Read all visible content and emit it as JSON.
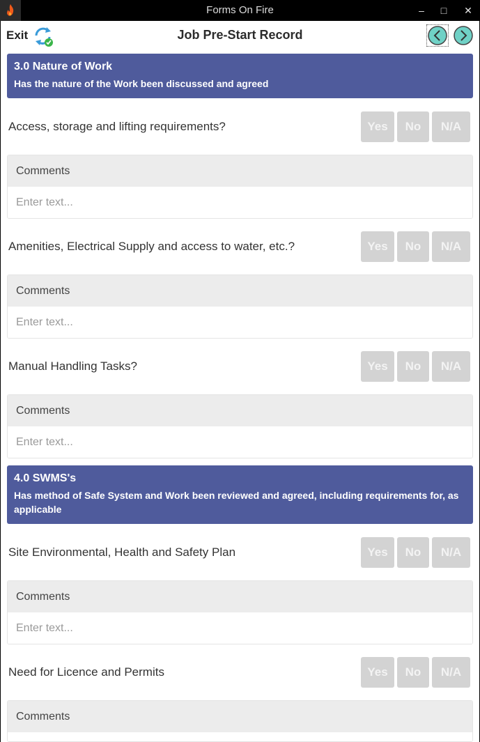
{
  "window": {
    "title": "Forms On Fire",
    "minimize_glyph": "‒",
    "maximize_glyph": "□",
    "close_glyph": "✕",
    "app_icon": "flame-icon"
  },
  "header": {
    "exit_label": "Exit",
    "sync_icon": "sync-icon",
    "title": "Job Pre-Start Record",
    "prev_icon": "chevron-left-icon",
    "next_icon": "chevron-right-icon"
  },
  "colors": {
    "section_bg": "#4f5b9c",
    "button_disabled": "#d3d3d3",
    "nav_accent": "#6fd1c6"
  },
  "sections": [
    {
      "title": "3.0 Nature of Work",
      "description": "Has the nature of the Work been discussed and agreed"
    },
    {
      "title": "4.0 SWMS's",
      "description": "Has method of Safe System and Work been reviewed and agreed, including requirements for, as applicable"
    }
  ],
  "buttons": {
    "yes": "Yes",
    "no": "No",
    "na": "N/A"
  },
  "comments": {
    "label": "Comments",
    "placeholder": "Enter text..."
  },
  "questions": [
    {
      "text": "Access, storage and lifting requirements?"
    },
    {
      "text": "Amenities, Electrical Supply and access to water, etc.?"
    },
    {
      "text": "Manual Handling Tasks?"
    },
    {
      "text": "Site Environmental, Health and Safety Plan"
    },
    {
      "text": "Need for Licence and Permits"
    }
  ]
}
